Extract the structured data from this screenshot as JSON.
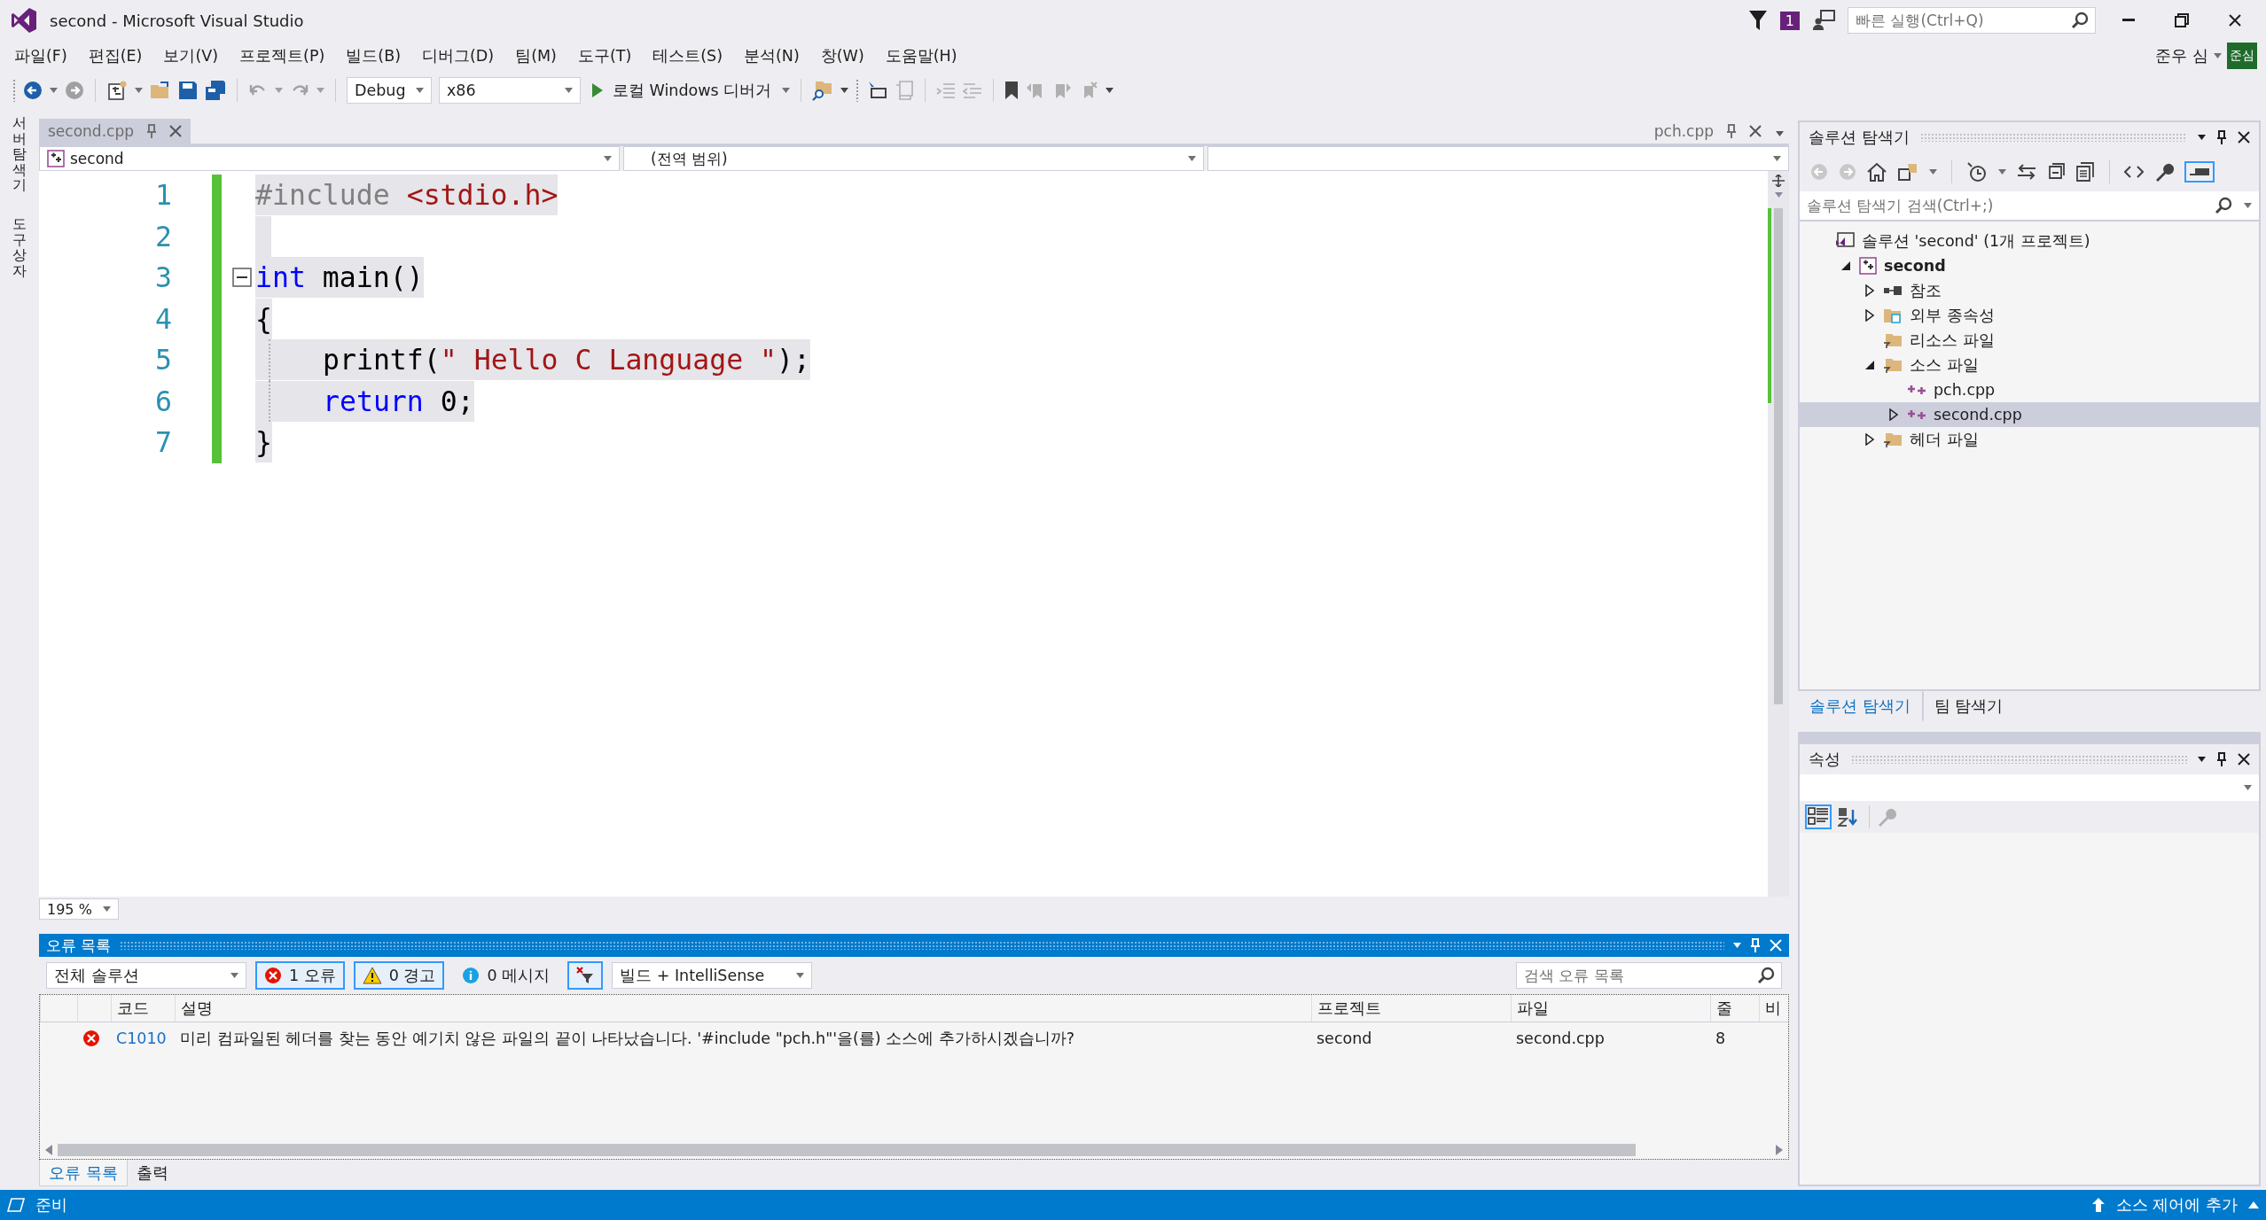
{
  "window": {
    "title": "second - Microsoft Visual Studio"
  },
  "notifications": {
    "count": "1"
  },
  "quick_launch": {
    "placeholder": "빠른 실행(Ctrl+Q)"
  },
  "user": {
    "name": "준우 심",
    "initials": "준심"
  },
  "menu": [
    "파일(F)",
    "편집(E)",
    "보기(V)",
    "프로젝트(P)",
    "빌드(B)",
    "디버그(D)",
    "팀(M)",
    "도구(T)",
    "테스트(S)",
    "분석(N)",
    "창(W)",
    "도움말(H)"
  ],
  "toolbar": {
    "configuration": "Debug",
    "platform": "x86",
    "run_label": "로컬 Windows 디버거"
  },
  "side_strip": [
    "서버 탐색기",
    "도구 상자"
  ],
  "editor": {
    "tabs": [
      {
        "label": "second.cpp",
        "selected": true
      },
      {
        "label": "pch.cpp",
        "selected": false
      }
    ],
    "nav": {
      "project": "second",
      "scope": "(전역 범위)"
    },
    "lines": [
      {
        "number": "1",
        "kind": "code",
        "selected": true,
        "indented": false,
        "tokens": [
          {
            "kind": "preproc",
            "text": "#include"
          },
          {
            "kind": "include",
            "text": "<stdio.h>"
          }
        ]
      },
      {
        "number": "2",
        "kind": "code",
        "selected": true,
        "indented": false
      },
      {
        "number": "3",
        "kind": "block_start",
        "selected": true,
        "indented": false,
        "tokens": [
          {
            "kind": "keyword",
            "text": "int"
          },
          {
            "kind": "plain",
            "text": " main()"
          }
        ]
      },
      {
        "number": "4",
        "kind": "code",
        "selected": true,
        "indented": false,
        "tokens": [
          {
            "kind": "plain",
            "text": "{"
          }
        ]
      },
      {
        "number": "5",
        "kind": "code",
        "selected": true,
        "indented": true,
        "tokens": [
          {
            "kind": "plain",
            "text": "printf("
          },
          {
            "kind": "string",
            "text": "\" Hello C Language \""
          },
          {
            "kind": "plain",
            "text": ");"
          }
        ]
      },
      {
        "number": "6",
        "kind": "code",
        "selected": true,
        "indented": true,
        "tokens": [
          {
            "kind": "keyword",
            "text": "return"
          },
          {
            "kind": "plain",
            "text": " 0;"
          }
        ]
      },
      {
        "number": "7",
        "kind": "code",
        "selected": true,
        "indented": false,
        "tokens": [
          {
            "kind": "plain",
            "text": "}"
          }
        ]
      }
    ],
    "zoom": "195 %"
  },
  "error_list": {
    "title": "오류 목록",
    "scope": "전체 솔루션",
    "filters": [
      {
        "kind": "error",
        "label": "1 오류",
        "on": true
      },
      {
        "kind": "warning",
        "label": "0 경고",
        "on": true
      },
      {
        "kind": "info",
        "label": "0 메시지",
        "on": false
      }
    ],
    "filter_button": {
      "on": true
    },
    "source": "빌드 + IntelliSense",
    "search": {
      "placeholder": "검색 오류 목록"
    },
    "columns": [
      "코드",
      "설명",
      "프로젝트",
      "파일",
      "줄",
      "비"
    ],
    "rows": [
      {
        "kind": "error",
        "code": "C1010",
        "description": "미리 컴파일된 헤더를 찾는 동안 예기치 않은 파일의 끝이 나타났습니다. '#include \"pch.h\"'을(를) 소스에 추가하시겠습니까?",
        "project": "second",
        "file": "second.cpp",
        "line": "8"
      }
    ],
    "tabs": [
      {
        "label": "오류 목록",
        "selected": true
      },
      {
        "label": "출력",
        "selected": false
      }
    ]
  },
  "solution_explorer": {
    "title": "솔루션 탐색기",
    "toolbar_toggle_on": true,
    "search": {
      "placeholder": "솔루션 탐색기 검색(Ctrl+;)"
    },
    "tree": [
      {
        "label": "솔루션 'second' (1개 프로젝트)",
        "kind": "solution",
        "selected": false,
        "children": [
          {
            "label": "second",
            "kind": "project",
            "expanded": true,
            "selected": false,
            "children": [
              {
                "label": "참조",
                "kind": "references",
                "expanded": false,
                "selected": false
              },
              {
                "label": "외부 종속성",
                "kind": "external",
                "expanded": false,
                "selected": false
              },
              {
                "label": "리소스 파일",
                "kind": "filter",
                "selected": false
              },
              {
                "label": "소스 파일",
                "kind": "filter",
                "expanded": true,
                "selected": false,
                "children": [
                  {
                    "label": "pch.cpp",
                    "kind": "cpp",
                    "selected": false
                  },
                  {
                    "label": "second.cpp",
                    "kind": "cpp",
                    "expanded": false,
                    "selected": true
                  }
                ]
              },
              {
                "label": "헤더 파일",
                "kind": "filter",
                "expanded": false,
                "selected": false
              }
            ]
          }
        ]
      }
    ],
    "tabs": [
      {
        "label": "솔루션 탐색기",
        "selected": true
      },
      {
        "label": "팀 탐색기",
        "selected": false
      }
    ]
  },
  "properties": {
    "title": "속성",
    "views": [
      {
        "kind": "categorized",
        "selected": true
      },
      {
        "kind": "alphabetical",
        "selected": false
      }
    ]
  },
  "status_bar": {
    "text": "준비",
    "source_control": "소스 제어에 추가"
  }
}
